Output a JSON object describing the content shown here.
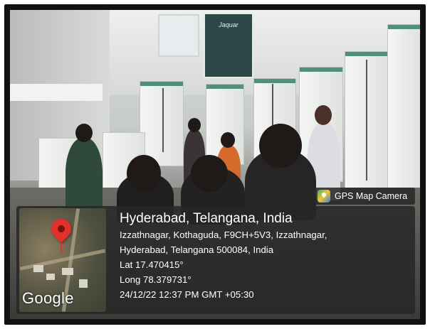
{
  "badge": {
    "icon": "map-pin-app-icon",
    "label": "GPS Map Camera"
  },
  "location": {
    "title": "Hyderabad, Telangana, India",
    "address_line1": "Izzathnagar, Kothaguda, F9CH+5V3, Izzathnagar,",
    "address_line2": "Hyderabad, Telangana 500084, India",
    "lat": "Lat 17.470415°",
    "long": "Long 78.379731°",
    "timestamp": "24/12/22 12:37 PM GMT +05:30"
  },
  "map": {
    "provider": "Google",
    "marker_color": "#e2302a",
    "marker_icon": "location-pin-icon"
  },
  "poster": {
    "brand": "Jaquar"
  }
}
